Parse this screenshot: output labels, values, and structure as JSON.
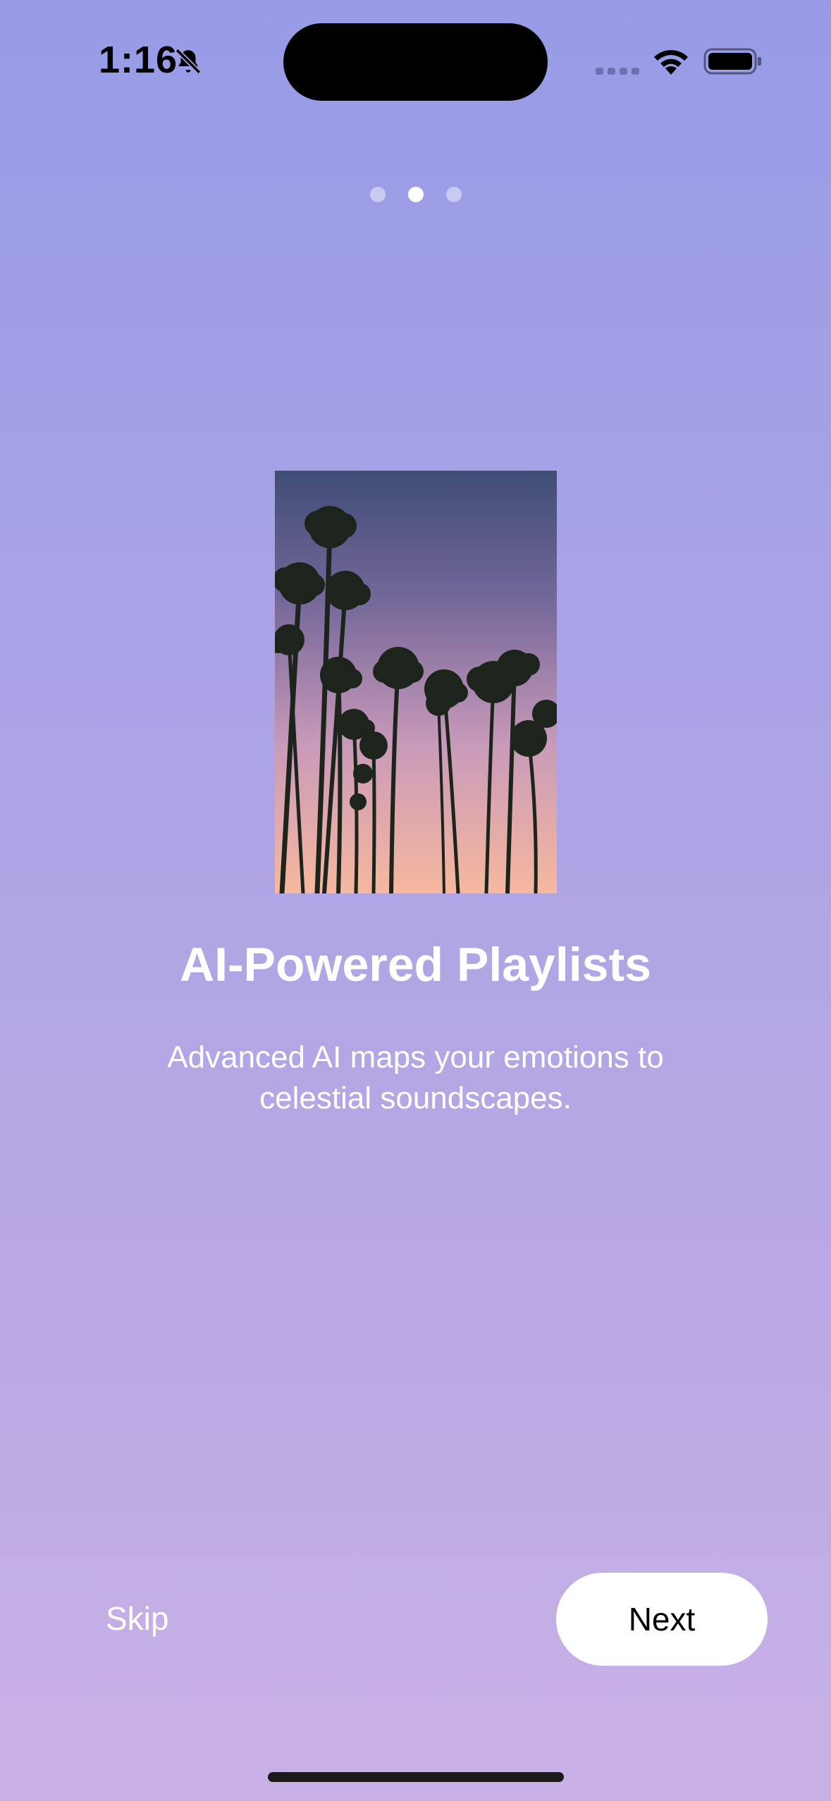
{
  "status_bar": {
    "time": "1:16",
    "icons": [
      "bell-slash-icon",
      "cellular-signal-icon",
      "wifi-icon",
      "battery-icon"
    ]
  },
  "pager": {
    "total_pages": 3,
    "current_page": 2
  },
  "hero": {
    "image": "palm-trees-sunset-photo"
  },
  "content": {
    "title": "AI-Powered Playlists",
    "subtitle": "Advanced AI maps your emotions to celestial soundscapes."
  },
  "actions": {
    "skip_label": "Skip",
    "next_label": "Next"
  },
  "colors": {
    "background_top": "#979be6",
    "background_bottom": "#c8b1e6",
    "button_bg": "#ffffff",
    "text": "#ffffff"
  }
}
